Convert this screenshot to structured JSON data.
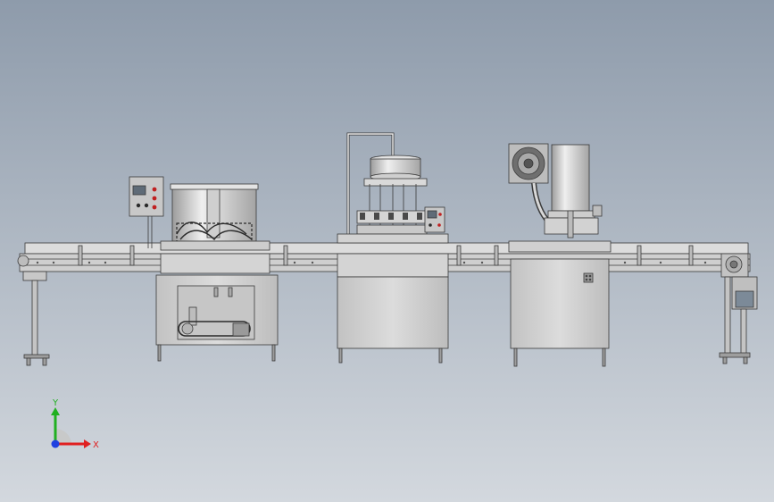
{
  "colors": {
    "bg_top": "#8e9bab",
    "bg_bottom": "#d3d8de",
    "metal": "#d8d8d8",
    "metal_dark": "#a8a8a8",
    "line": "#3a3a3a",
    "panel": "#c9c9c9",
    "axis_x": "#e02020",
    "axis_y": "#20b020",
    "axis_z": "#2040e0"
  },
  "triad": {
    "x_label": "X",
    "y_label": "Y"
  }
}
